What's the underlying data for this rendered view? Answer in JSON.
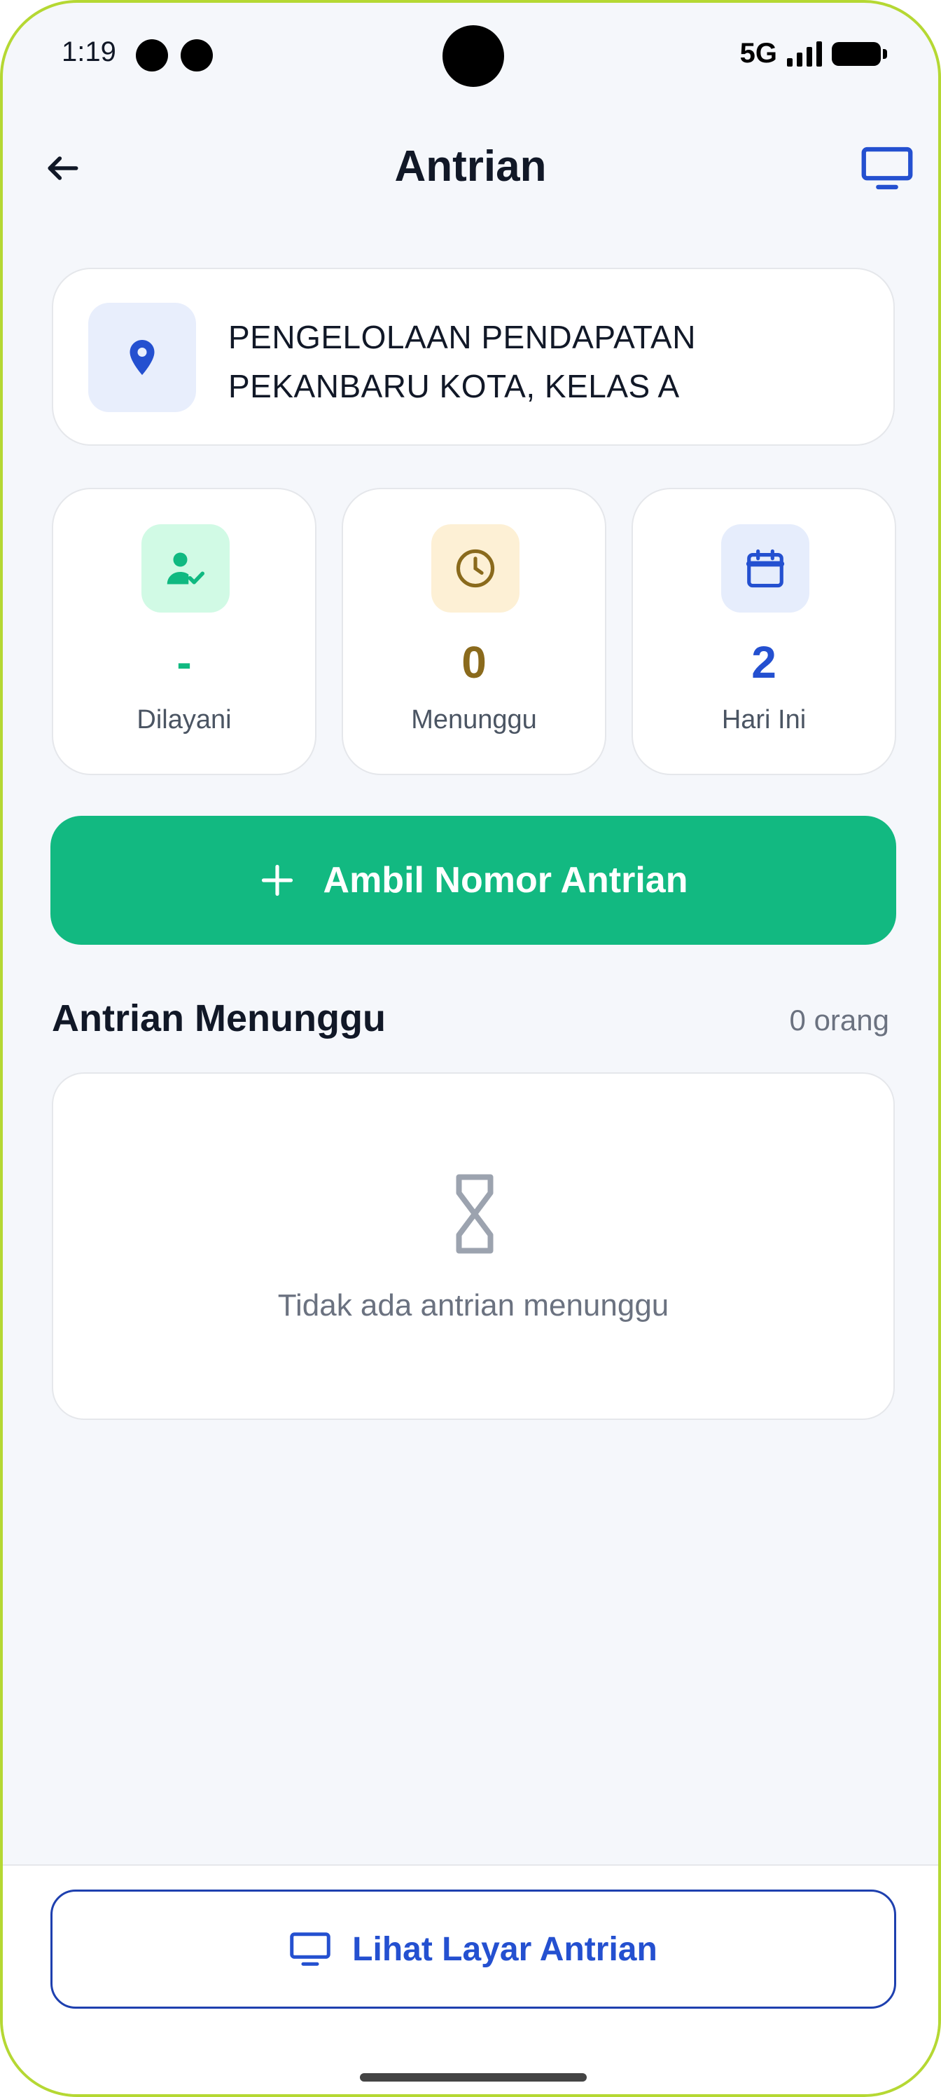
{
  "status_bar": {
    "time": "1:19",
    "network": "5G"
  },
  "header": {
    "title": "Antrian",
    "back_icon": "arrow-left-icon",
    "display_icon": "monitor-icon"
  },
  "location": {
    "icon": "map-pin-icon",
    "name": "PENGELOLAAN PENDAPATAN PEKANBARU KOTA, KELAS A"
  },
  "stats": [
    {
      "icon": "user-check-icon",
      "value": "-",
      "label": "Dilayani",
      "color": "#10b981",
      "bg": "#d1fae5"
    },
    {
      "icon": "clock-icon",
      "value": "0",
      "label": "Menunggu",
      "color": "#8a6a1c",
      "bg": "#fdf0d5"
    },
    {
      "icon": "calendar-icon",
      "value": "2",
      "label": "Hari Ini",
      "color": "#2450d0",
      "bg": "#e6edfc"
    }
  ],
  "primary_action": {
    "icon": "plus-icon",
    "label": "Ambil Nomor Antrian",
    "color": "#12b981"
  },
  "waiting": {
    "title": "Antrian Menunggu",
    "count": "0 orang",
    "empty_icon": "hourglass-icon",
    "empty_text": "Tidak ada antrian menunggu"
  },
  "bottom_action": {
    "icon": "monitor-icon",
    "label": "Lihat Layar Antrian",
    "color": "#2450d0"
  }
}
